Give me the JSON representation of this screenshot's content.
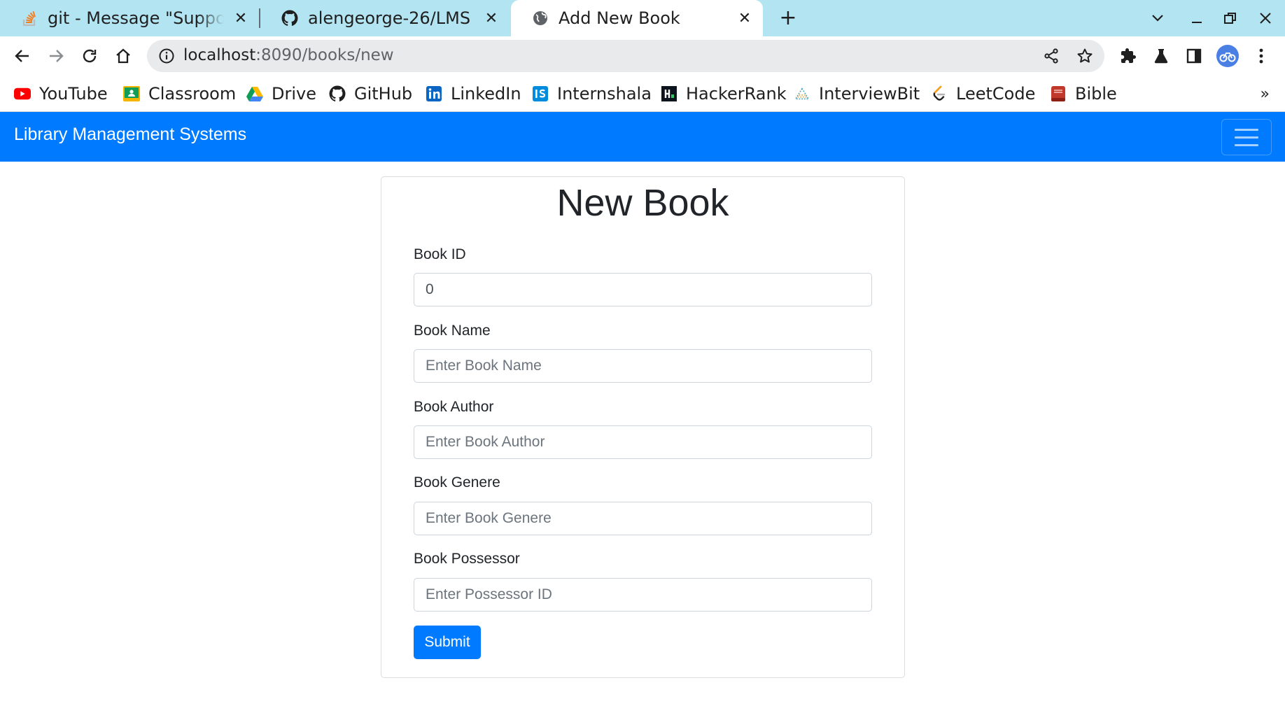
{
  "browser": {
    "tabs": [
      {
        "title": "git - Message \"Support f",
        "favicon": "stackoverflow-icon",
        "active": false
      },
      {
        "title": "alengeorge-26/LMS",
        "favicon": "github-icon",
        "active": false
      },
      {
        "title": "Add New Book",
        "favicon": "globe-icon",
        "active": true
      }
    ],
    "close_glyph": "✕",
    "new_tab_glyph": "+",
    "address": {
      "host": "localhost",
      "path": ":8090/books/new"
    },
    "bookmarks": [
      {
        "label": "YouTube",
        "icon": "youtube-icon",
        "color": "#ff0000"
      },
      {
        "label": "Classroom",
        "icon": "classroom-icon",
        "color": "#f4b400"
      },
      {
        "label": "Drive",
        "icon": "drive-icon",
        "color": "#1fa463"
      },
      {
        "label": "GitHub",
        "icon": "github-icon",
        "color": "#1f1f1f"
      },
      {
        "label": "LinkedIn",
        "icon": "linkedin-icon",
        "color": "#0a66c2"
      },
      {
        "label": "Internshala",
        "icon": "internshala-icon",
        "color": "#008bdc"
      },
      {
        "label": "HackerRank",
        "icon": "hackerrank-icon",
        "color": "#0e141e"
      },
      {
        "label": "InterviewBit",
        "icon": "interviewbit-icon",
        "color": "#3aa3b8"
      },
      {
        "label": "LeetCode",
        "icon": "leetcode-icon",
        "color": "#ffa116"
      },
      {
        "label": "Bible",
        "icon": "bible-icon",
        "color": "#c0392b"
      }
    ],
    "bookmarks_overflow": "»"
  },
  "app": {
    "brand": "Library Management Systems",
    "navbar_color": "#007bff"
  },
  "form": {
    "title": "New Book",
    "fields": [
      {
        "label": "Book ID",
        "value": "0",
        "placeholder": ""
      },
      {
        "label": "Book Name",
        "value": "",
        "placeholder": "Enter Book Name"
      },
      {
        "label": "Book Author",
        "value": "",
        "placeholder": "Enter Book Author"
      },
      {
        "label": "Book Genere",
        "value": "",
        "placeholder": "Enter Book Genere"
      },
      {
        "label": "Book Possessor",
        "value": "",
        "placeholder": "Enter Possessor ID"
      }
    ],
    "submit_label": "Submit"
  }
}
